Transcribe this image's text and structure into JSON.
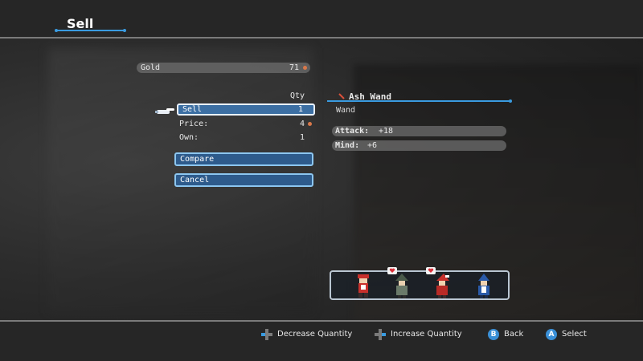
{
  "screen": {
    "title": "Sell"
  },
  "gold": {
    "label": "Gold",
    "amount": "71"
  },
  "sell_menu": {
    "qty_header": "Qty",
    "sell_label": "Sell",
    "sell_qty": "1",
    "price_label": "Price:",
    "price_value": "4",
    "own_label": "Own:",
    "own_value": "1",
    "compare_label": "Compare",
    "cancel_label": "Cancel"
  },
  "item": {
    "name": "Ash Wand",
    "type": "Wand",
    "icon": "wand-icon",
    "stats": [
      {
        "name": "Attack:",
        "value": "+18"
      },
      {
        "name": "Mind:",
        "value": "+6"
      }
    ]
  },
  "party": {
    "members": [
      "red-mage-character",
      "witch-character",
      "red-wizard-character",
      "blue-mage-character"
    ],
    "can_equip_markers": [
      "witch-character",
      "red-wizard-character"
    ]
  },
  "controls": {
    "decrease": "Decrease Quantity",
    "increase": "Increase Quantity",
    "back": "Back",
    "select": "Select",
    "back_button_glyph": "B",
    "select_button_glyph": "A"
  },
  "colors": {
    "accent": "#3a9be0",
    "selected_row": "#3c6fa3",
    "coin": "#d9784a"
  }
}
